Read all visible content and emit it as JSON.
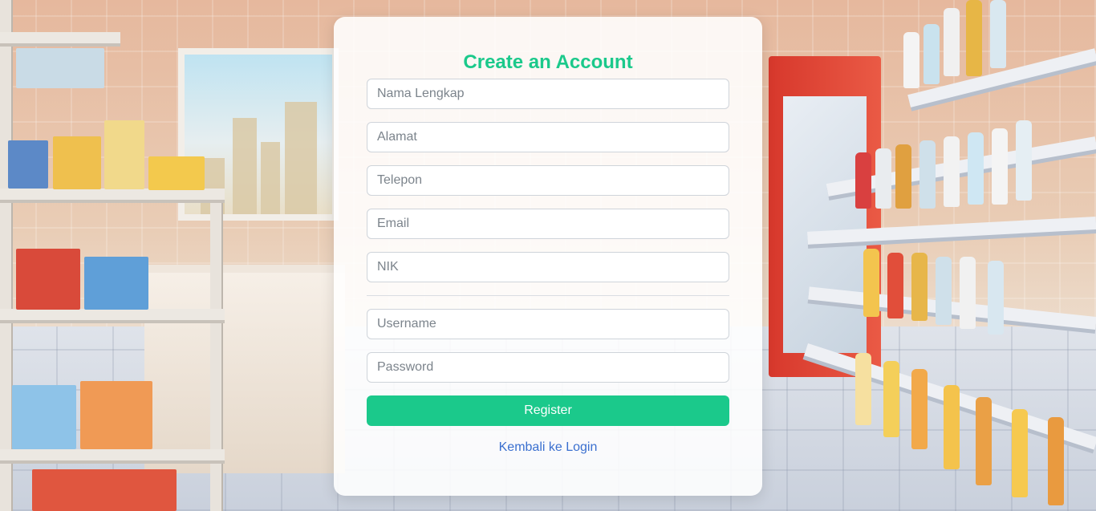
{
  "form": {
    "title": "Create an Account",
    "fields": {
      "nama_lengkap": {
        "placeholder": "Nama Lengkap",
        "value": ""
      },
      "alamat": {
        "placeholder": "Alamat",
        "value": ""
      },
      "telepon": {
        "placeholder": "Telepon",
        "value": ""
      },
      "email": {
        "placeholder": "Email",
        "value": ""
      },
      "nik": {
        "placeholder": "NIK",
        "value": ""
      },
      "username": {
        "placeholder": "Username",
        "value": ""
      },
      "password": {
        "placeholder": "Password",
        "value": ""
      }
    },
    "register_label": "Register",
    "back_to_login_label": "Kembali ke Login"
  },
  "colors": {
    "accent": "#1bc98b",
    "link": "#3a6fcf"
  }
}
